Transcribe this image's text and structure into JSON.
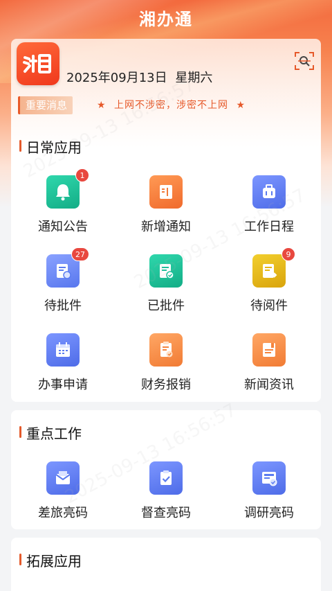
{
  "app": {
    "title": "湘办通"
  },
  "header": {
    "date": "2025年09月13日",
    "weekday": "星期六",
    "notice_tag": "重要消息",
    "notice_text": "上网不涉密，涉密不上网"
  },
  "sections": {
    "daily": {
      "title": "日常应用",
      "items": [
        {
          "label": "通知公告",
          "icon": "bell-icon",
          "badge": "1"
        },
        {
          "label": "新增通知",
          "icon": "notebook-icon",
          "badge": ""
        },
        {
          "label": "工作日程",
          "icon": "briefcase-icon",
          "badge": ""
        },
        {
          "label": "待批件",
          "icon": "document-stamp-icon",
          "badge": "27"
        },
        {
          "label": "已批件",
          "icon": "document-check-icon",
          "badge": ""
        },
        {
          "label": "待阅件",
          "icon": "document-forward-icon",
          "badge": "9"
        },
        {
          "label": "办事申请",
          "icon": "calendar-icon",
          "badge": ""
        },
        {
          "label": "财务报销",
          "icon": "clipboard-check-icon",
          "badge": ""
        },
        {
          "label": "新闻资讯",
          "icon": "newspaper-icon",
          "badge": ""
        }
      ]
    },
    "key": {
      "title": "重点工作",
      "items": [
        {
          "label": "差旅亮码",
          "icon": "envelope-icon"
        },
        {
          "label": "督查亮码",
          "icon": "clipboard-icon"
        },
        {
          "label": "调研亮码",
          "icon": "report-check-icon"
        }
      ]
    },
    "ext": {
      "title": "拓展应用"
    }
  },
  "watermark": "2025-09-13 16:56:57",
  "colors": {
    "accent": "#e45a2b",
    "badge": "#e8483f",
    "teal": "#1fbf9a",
    "orange": "#f5843d",
    "blue": "#5b7cf0",
    "yellow": "#e6b715"
  }
}
